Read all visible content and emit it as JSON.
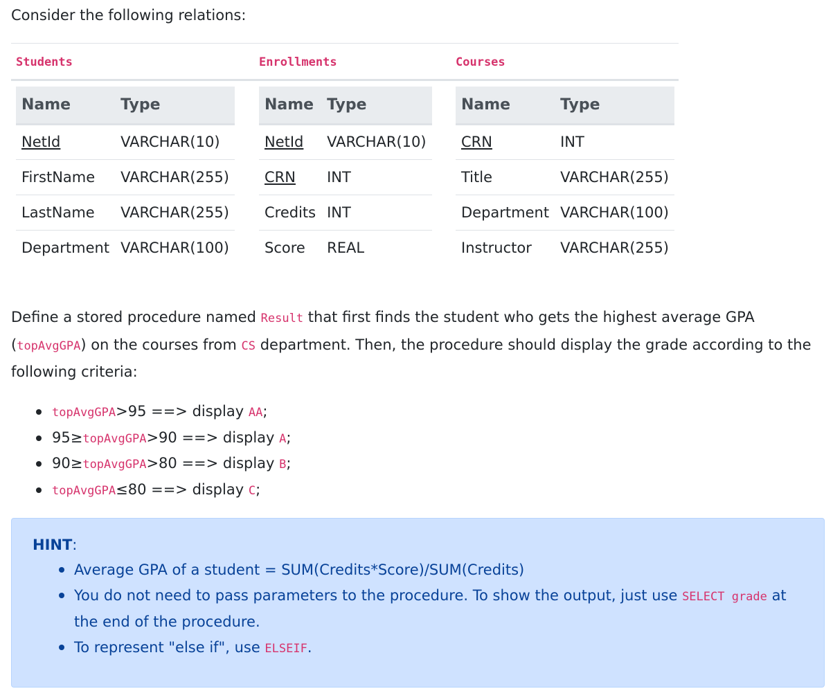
{
  "intro": "Consider the following relations:",
  "relations": [
    {
      "name": "Students",
      "headers": [
        "Name",
        "Type"
      ],
      "rows": [
        {
          "name": "NetId",
          "type": "VARCHAR(10)",
          "pk": true
        },
        {
          "name": "FirstName",
          "type": "VARCHAR(255)",
          "pk": false
        },
        {
          "name": "LastName",
          "type": "VARCHAR(255)",
          "pk": false
        },
        {
          "name": "Department",
          "type": "VARCHAR(100)",
          "pk": false
        }
      ]
    },
    {
      "name": "Enrollments",
      "headers": [
        "Name",
        "Type"
      ],
      "rows": [
        {
          "name": "NetId",
          "type": "VARCHAR(10)",
          "pk": true
        },
        {
          "name": "CRN",
          "type": "INT",
          "pk": true
        },
        {
          "name": "Credits",
          "type": "INT",
          "pk": false
        },
        {
          "name": "Score",
          "type": "REAL",
          "pk": false
        }
      ]
    },
    {
      "name": "Courses",
      "headers": [
        "Name",
        "Type"
      ],
      "rows": [
        {
          "name": "CRN",
          "type": "INT",
          "pk": true
        },
        {
          "name": "Title",
          "type": "VARCHAR(255)",
          "pk": false
        },
        {
          "name": "Department",
          "type": "VARCHAR(100)",
          "pk": false
        },
        {
          "name": "Instructor",
          "type": "VARCHAR(255)",
          "pk": false
        }
      ]
    }
  ],
  "task": {
    "t1": "Define a stored procedure named ",
    "c1": "Result",
    "t2": " that first finds the student who gets the highest average GPA (",
    "c2": "topAvgGPA",
    "t3": ") on the courses from ",
    "c3": "CS",
    "t4": " department. Then, the procedure should display the grade according to the following criteria:"
  },
  "criteria": [
    {
      "pre": "",
      "code": "topAvgGPA",
      "post": ">95 ==> display ",
      "grade": "AA",
      "end": ";"
    },
    {
      "pre": "95≥",
      "code": "topAvgGPA",
      "post": ">90 ==> display ",
      "grade": "A",
      "end": ";"
    },
    {
      "pre": "90≥",
      "code": "topAvgGPA",
      "post": ">80 ==> display ",
      "grade": "B",
      "end": ";"
    },
    {
      "pre": "",
      "code": "topAvgGPA",
      "post": "≤80 ==> display ",
      "grade": "C",
      "end": ";"
    }
  ],
  "hint": {
    "title": "HINT",
    "colon": ":",
    "item1": "Average GPA of a student = SUM(Credits*Score)/SUM(Credits)",
    "item2_pre": "You do not need to pass parameters to the procedure. To show the output, just use ",
    "item2_code": "SELECT grade",
    "item2_post": " at the end of the procedure.",
    "item3_pre": "To represent \"else if\", use ",
    "item3_code": "ELSEIF",
    "item3_post": "."
  },
  "colors": {
    "code": "#d6336c",
    "hint_bg": "#cfe2ff",
    "hint_text": "#084298",
    "table_header_bg": "#e9ecef"
  }
}
